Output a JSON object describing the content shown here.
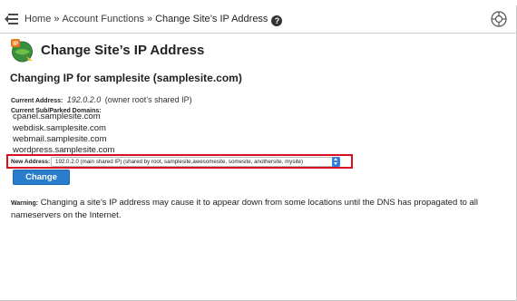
{
  "breadcrumb": {
    "home": "Home",
    "separator": "»",
    "section": "Account Functions",
    "current": "Change Site’s IP Address",
    "help_icon": "?"
  },
  "icons": {
    "menu": "menu-collapse-icon",
    "help": "help-icon",
    "support": "lifebuoy-icon",
    "page": "change-ip-icon",
    "select": "select-arrows-icon"
  },
  "page": {
    "title": "Change Site’s IP Address",
    "subtitle": "Changing IP for samplesite (samplesite.com)"
  },
  "current_address": {
    "label": "Current Address:",
    "ip": "192.0.2.0",
    "note": "(owner root’s shared IP)"
  },
  "domains": {
    "label": "Current Sub/Parked Domains:",
    "items": [
      "cpanel.samplesite.com",
      "webdisk.samplesite.com",
      "webmail.samplesite.com",
      "wordpress.samplesite.com"
    ]
  },
  "new_address": {
    "label": "New Address:",
    "selected": "192.0.2.0 (main shared IP) (shared by root, samplesite,awesomesite, somesite, anothersite, mysite)"
  },
  "change_button": {
    "label": "Change"
  },
  "warning": {
    "label": "Warning:",
    "text": "Changing a site’s IP address may cause it to appear down from some locations until the DNS has propagated to all nameservers on the Internet."
  },
  "colors": {
    "accent": "#2a7ccc",
    "highlight": "#d9101f",
    "select_arrows": "#2f7de1"
  }
}
